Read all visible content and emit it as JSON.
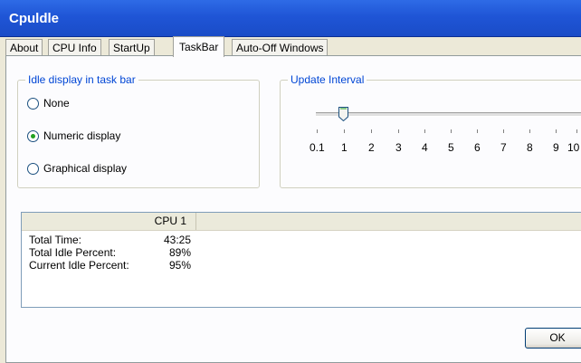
{
  "window": {
    "title": "Cpuldle"
  },
  "tabs": [
    {
      "label": "About"
    },
    {
      "label": "CPU Info"
    },
    {
      "label": "StartUp"
    },
    {
      "label": "TaskBar",
      "active": true
    },
    {
      "label": "Auto-Off Windows"
    }
  ],
  "idle_display": {
    "group_title": "Idle display in task bar",
    "options": [
      {
        "label": "None",
        "checked": false
      },
      {
        "label": "Numeric display",
        "checked": true
      },
      {
        "label": "Graphical display",
        "checked": false
      }
    ]
  },
  "update_interval": {
    "group_title": "Update Interval",
    "value": 1,
    "tick_labels": [
      "0.1",
      "1",
      "2",
      "3",
      "4",
      "5",
      "6",
      "7",
      "8",
      "9",
      "10"
    ]
  },
  "stats": {
    "column_header": "CPU 1",
    "rows": [
      {
        "label": "Total Time:",
        "value": "43:25"
      },
      {
        "label": "Total Idle Percent:",
        "value": "89%"
      },
      {
        "label": "Current Idle Percent:",
        "value": "95%"
      }
    ]
  },
  "buttons": {
    "ok_label": "OK"
  }
}
